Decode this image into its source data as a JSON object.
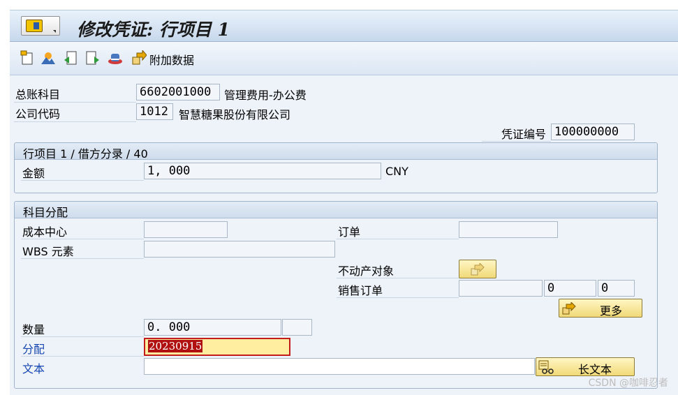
{
  "title": "修改凭证: 行项目 1",
  "toolbar": {
    "icons": [
      "new-document-icon",
      "landscape-icon",
      "previous-document-icon",
      "next-document-icon",
      "hat-icon",
      "arrow-icon"
    ],
    "additional_data": "附加数据"
  },
  "header": {
    "gl_account_label": "总账科目",
    "gl_account_value": "6602001000",
    "gl_account_desc": "管理费用-办公费",
    "company_code_label": "公司代码",
    "company_code_value": "1012",
    "company_code_desc": "智慧糖果股份有限公司",
    "doc_number_label": "凭证编号",
    "doc_number_value": "100000000"
  },
  "line_item": {
    "title": "行项目 1 / 借方分录 / 40",
    "amount_label": "金额",
    "amount_value": "1, 000",
    "currency": "CNY"
  },
  "account_assignment": {
    "title": "科目分配",
    "cost_center_label": "成本中心",
    "cost_center_value": "",
    "order_label": "订单",
    "order_value": "",
    "wbs_label": "WBS 元素",
    "wbs_value": "",
    "real_estate_label": "不动产对象",
    "sales_order_label": "销售订单",
    "sales_order_value": "",
    "sales_order_item": "0",
    "sales_order_schedule": "0",
    "more_button": "更多"
  },
  "bottom": {
    "quantity_label": "数量",
    "quantity_value": "0. 000",
    "quantity_unit": "",
    "assignment_label": "分配",
    "assignment_value": "20230915",
    "text_label": "文本",
    "text_value": "",
    "long_text_button": "长文本"
  },
  "watermark": "CSDN @咖啡忍者",
  "colors": {
    "accent_blue": "#1747b0",
    "button_yellow": "#f1d978",
    "error_red": "#c21c1c"
  }
}
